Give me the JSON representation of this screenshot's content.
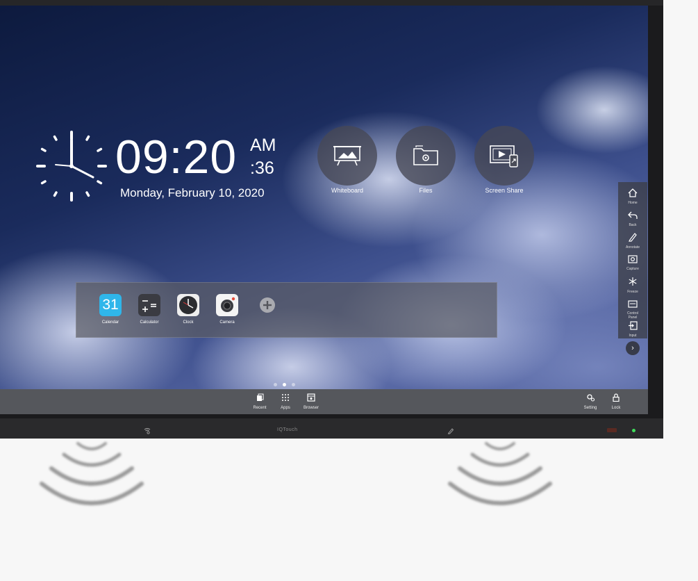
{
  "clock": {
    "time": "09:20",
    "ampm": "AM",
    "seconds": ":36",
    "date": "Monday, February 10, 2020"
  },
  "apps": [
    {
      "label": "Whiteboard",
      "icon": "whiteboard-icon"
    },
    {
      "label": "Files",
      "icon": "files-icon"
    },
    {
      "label": "Screen Share",
      "icon": "screen-share-icon"
    }
  ],
  "dock": {
    "items": [
      {
        "label": "Calendar",
        "icon": "calendar-icon",
        "value": "31"
      },
      {
        "label": "Calculator",
        "icon": "calculator-icon"
      },
      {
        "label": "Clock",
        "icon": "clock-icon"
      },
      {
        "label": "Camera",
        "icon": "camera-icon"
      }
    ],
    "add_icon": "add-icon"
  },
  "sidebar": {
    "items": [
      {
        "label": "Home",
        "icon": "home-icon"
      },
      {
        "label": "Back",
        "icon": "back-icon"
      },
      {
        "label": "Annotate",
        "icon": "annotate-icon"
      },
      {
        "label": "Capture",
        "icon": "capture-icon"
      },
      {
        "label": "Freeze",
        "icon": "freeze-icon"
      },
      {
        "label": "Control Panel",
        "icon": "control-panel-icon"
      },
      {
        "label": "Input",
        "icon": "input-icon"
      }
    ],
    "more_label": "›"
  },
  "pager": {
    "pages": 3,
    "active": 2
  },
  "taskbar": {
    "center": [
      {
        "label": "Recent",
        "icon": "recent-icon"
      },
      {
        "label": "Apps",
        "icon": "apps-grid-icon"
      },
      {
        "label": "Browser",
        "icon": "browser-icon"
      }
    ],
    "right": [
      {
        "label": "Setting",
        "icon": "settings-icon"
      },
      {
        "label": "Lock",
        "icon": "lock-icon"
      }
    ]
  },
  "device": {
    "brand": "IQTouch",
    "led_color": "#3fdc5a"
  }
}
